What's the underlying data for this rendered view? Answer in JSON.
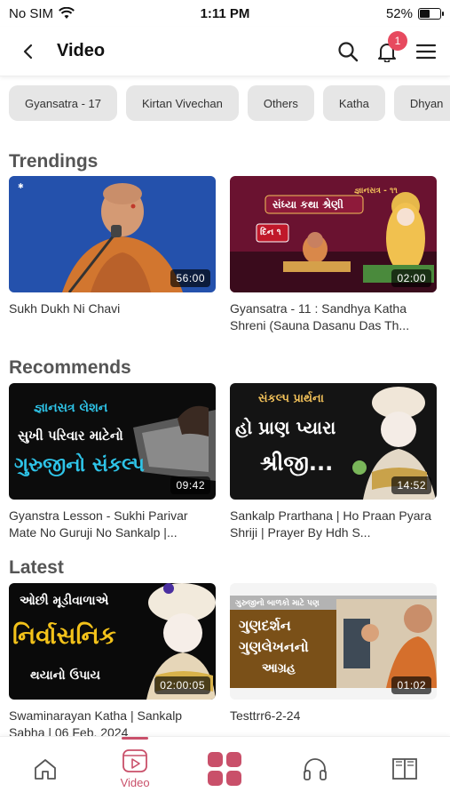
{
  "status": {
    "carrier": "No SIM",
    "time": "1:11 PM",
    "battery": "52%",
    "battery_level": 0.52
  },
  "header": {
    "title": "Video",
    "notification_count": "1"
  },
  "chips": [
    "Gyansatra - 17",
    "Kirtan Vivechan",
    "Others",
    "Katha",
    "Dhyan"
  ],
  "sections": {
    "trendings": {
      "title": "Trendings",
      "items": [
        {
          "title": "Sukh Dukh Ni Chavi",
          "duration": "56:00"
        },
        {
          "title": "Gyansatra - 11 : Sandhya Katha Shreni (Sauna Dasanu Das Th...",
          "duration": "02:00",
          "thumb_text": {
            "top": "જ્ઞાનસત્ર - ૧૧",
            "main": "સંધ્યા કથા શ્રેણી",
            "day": "દિન ૧"
          }
        }
      ]
    },
    "recommends": {
      "title": "Recommends",
      "items": [
        {
          "title": "Gyanstra Lesson - Sukhi Parivar Mate No Guruji No Sankalp |...",
          "duration": "09:42",
          "thumb_text": {
            "line1": "જ્ઞાનસત્ર લેશન",
            "line2": "સુખી પરિવાર માટેનો",
            "line3": "ગુરુજીનો સંકલ્પ"
          }
        },
        {
          "title": "Sankalp Prarthana | Ho Praan Pyara Shriji | Prayer By Hdh S...",
          "duration": "14:52",
          "thumb_text": {
            "line1": "સંકલ્પ પ્રાર્થના",
            "line2": "હો પ્રાણ પ્યારા",
            "line3": "શ્રીજી..."
          }
        }
      ]
    },
    "latest": {
      "title": "Latest",
      "items": [
        {
          "title": "Swaminarayan Katha | Sankalp Sabha | 06 Feb. 2024",
          "duration": "02:00:05",
          "thumb_text": {
            "line1": "ઓછી મૂડીવાળાએ",
            "line2": "નિર્વાસનિક",
            "line3": "થયાનો ઉપાય"
          }
        },
        {
          "title": "Testtrr6-2-24",
          "duration": "01:02",
          "thumb_text": {
            "line1": "ગુરુજીનો બાળકો માટે પણ",
            "line2": "ગુણદર્શન",
            "line3": "ગુણલેખનનો",
            "line4": "આગ્રહ"
          }
        }
      ]
    }
  },
  "bottom_nav": {
    "active_label": "Video"
  },
  "colors": {
    "accent": "#c9506a",
    "badge": "#e74a5f",
    "chip_bg": "#e6e6e6"
  }
}
